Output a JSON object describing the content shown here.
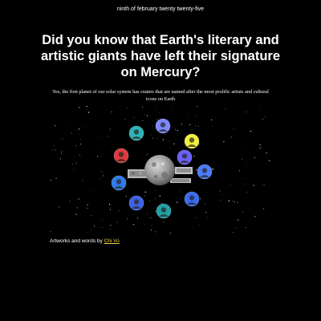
{
  "header": {
    "date": "ninth of february twenty twenty-five"
  },
  "article": {
    "headline": "Did you know that Earth's literary and artistic giants have left their signature on Mercury?",
    "body": "Yes, the first planet of our solar system has craters that are named after the most prolific artists and cultural icons on Earth"
  },
  "artwork": {
    "center_icon": "mercury-planet-icon",
    "portraits": [
      {
        "icon": "portrait-icon",
        "color": "#2bb3b8"
      },
      {
        "icon": "portrait-icon",
        "color": "#7d88ff"
      },
      {
        "icon": "portrait-icon",
        "color": "#e03a3e"
      },
      {
        "icon": "portrait-icon",
        "color": "#f1f13a"
      },
      {
        "icon": "portrait-icon",
        "color": "#4a7cff"
      },
      {
        "icon": "portrait-icon",
        "color": "#2f7bf0"
      },
      {
        "icon": "portrait-icon",
        "color": "#3a6cf2"
      },
      {
        "icon": "portrait-icon",
        "color": "#3d63e8"
      },
      {
        "icon": "portrait-icon",
        "color": "#1fa1a6"
      },
      {
        "icon": "portrait-icon",
        "color": "#6a60ff"
      }
    ]
  },
  "footer": {
    "credit_prefix": "Artworks and words by",
    "author_link": "Chi Vo",
    "link_color": "#f1d23a"
  }
}
